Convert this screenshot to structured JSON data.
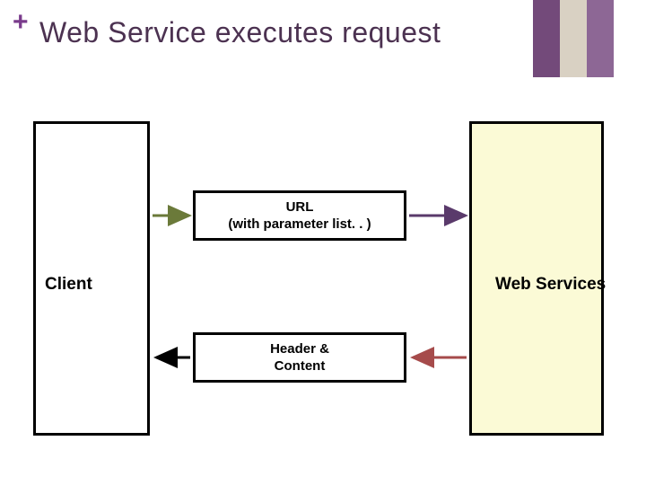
{
  "plus": "+",
  "title": "Web Service executes request",
  "client_label": "Client",
  "server_label": "Web Services",
  "url_box": {
    "line1": "URL",
    "line2": "(with parameter list. . )"
  },
  "hc_box": {
    "line1": "Header &",
    "line2": "Content"
  },
  "colors": {
    "accent": "#7a3b8c",
    "title": "#4c3251",
    "arrow_out_left": "#6b7a3a",
    "arrow_out_right": "#5a3a6b",
    "arrow_in_right": "#a64b4b",
    "arrow_in_left": "#000000"
  }
}
